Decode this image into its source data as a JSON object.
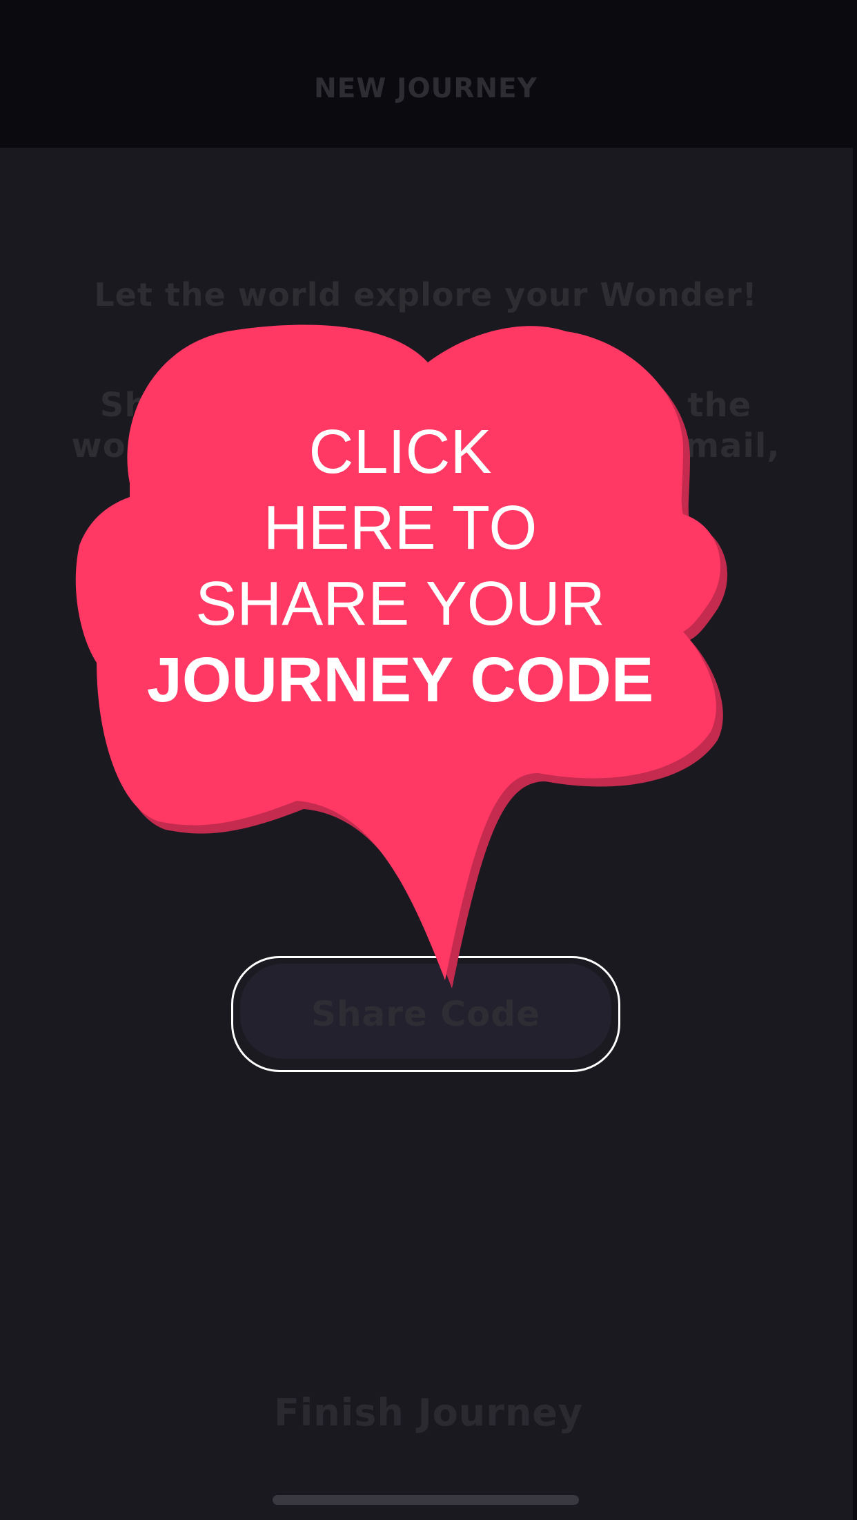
{
  "header": {
    "title": "NEW JOURNEY"
  },
  "main": {
    "heading": "Let the world explore your Wonder!",
    "description": "Share your Journey Code with the world using our share button, email, text or social media!",
    "share_button_label": "Share Code",
    "finish_label": "Finish Journey"
  },
  "tooltip": {
    "line1": "CLICK",
    "line2": "HERE TO",
    "line3": "SHARE YOUR",
    "emphasis": "JOURNEY CODE",
    "color": "#ff3864",
    "shadow_color": "#c42b4f"
  },
  "colors": {
    "background": "#1b1920",
    "header_background": "#0b0a0f"
  }
}
